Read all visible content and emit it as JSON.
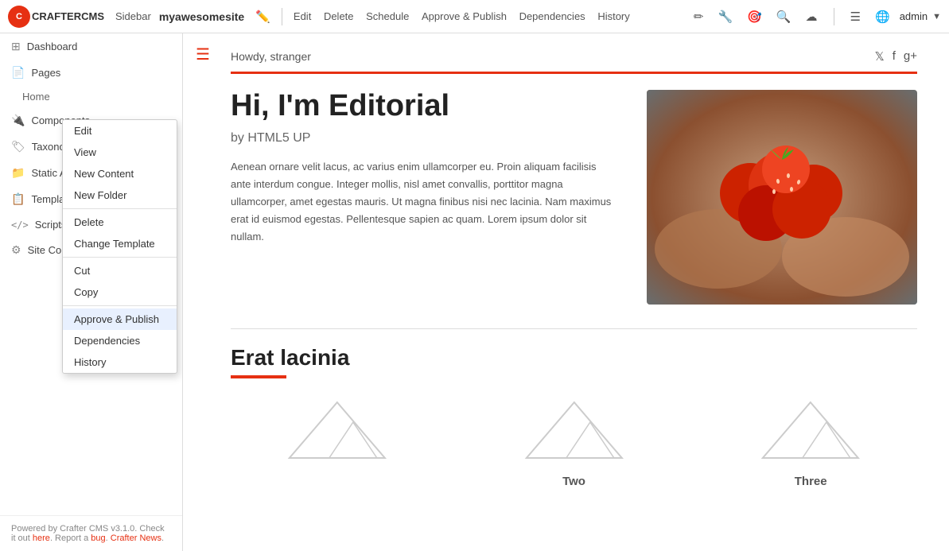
{
  "topbar": {
    "logo_text": "CRAFTERCMS",
    "sidebar_label": "Sidebar",
    "site_name": "myawesomesite",
    "nav_items": [
      "Edit",
      "Delete",
      "Schedule",
      "Approve & Publish",
      "Dependencies",
      "History"
    ],
    "admin_label": "admin"
  },
  "sidebar": {
    "items": [
      {
        "id": "dashboard",
        "label": "Dashboard",
        "icon": "⊞"
      },
      {
        "id": "pages",
        "label": "Pages",
        "icon": "📄"
      },
      {
        "id": "home",
        "label": "Home",
        "icon": ""
      },
      {
        "id": "components",
        "label": "Components",
        "icon": "🔌"
      },
      {
        "id": "taxonomy",
        "label": "Taxonomy",
        "icon": "🏷"
      },
      {
        "id": "static",
        "label": "Static A...",
        "icon": "📁"
      },
      {
        "id": "templates",
        "label": "Templates",
        "icon": "📋"
      },
      {
        "id": "scripts",
        "label": "Scripts",
        "icon": "< >"
      },
      {
        "id": "site-config",
        "label": "Site Co...",
        "icon": "⚙"
      }
    ],
    "footer": "Powered by Crafter CMS v3.1.0. Check it out ",
    "footer_link1": "here",
    "footer_sep": ". Report a ",
    "footer_link2": "bug",
    "footer_sep2": ". ",
    "footer_link3": "Crafter News",
    "footer_end": "."
  },
  "context_menu": {
    "items": [
      {
        "id": "edit",
        "label": "Edit"
      },
      {
        "id": "view",
        "label": "View"
      },
      {
        "id": "new-content",
        "label": "New Content"
      },
      {
        "id": "new-folder",
        "label": "New Folder"
      },
      {
        "id": "delete",
        "label": "Delete"
      },
      {
        "id": "change-template",
        "label": "Change Template"
      },
      {
        "id": "cut",
        "label": "Cut"
      },
      {
        "id": "copy",
        "label": "Copy"
      },
      {
        "id": "approve-publish",
        "label": "Approve & Publish",
        "highlighted": true
      },
      {
        "id": "dependencies",
        "label": "Dependencies"
      },
      {
        "id": "history",
        "label": "History"
      }
    ]
  },
  "main": {
    "howdy": "Howdy, stranger",
    "title": "Hi, I'm Editorial",
    "subtitle": "by HTML5 UP",
    "paragraph": "Aenean ornare velit lacus, ac varius enim ullamcorper eu. Proin aliquam facilisis ante interdum congue. Integer mollis, nisl amet convallis, porttitor magna ullamcorper, amet egestas mauris. Ut magna finibus nisi nec lacinia. Nam maximus erat id euismod egestas. Pellentesque sapien ac quam. Lorem ipsum dolor sit nullam.",
    "section_title": "Erat lacinia",
    "card2_label": "Two",
    "card3_label": "Three"
  }
}
